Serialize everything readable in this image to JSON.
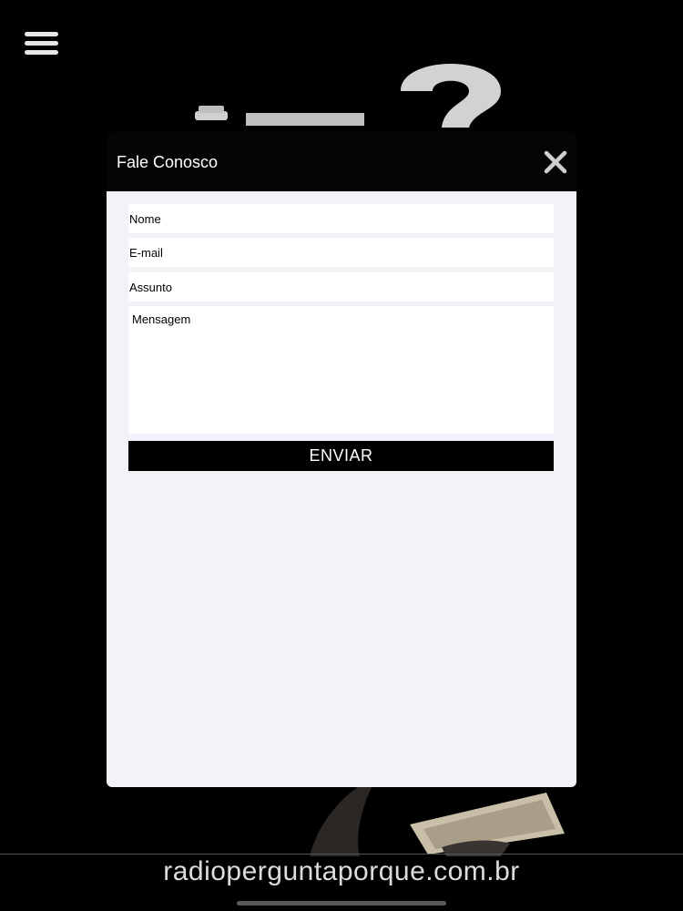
{
  "menu": {
    "icon": "hamburger-menu-icon"
  },
  "modal": {
    "title": "Fale Conosco",
    "close_icon": "close-icon",
    "form": {
      "name_placeholder": "Nome",
      "email_placeholder": "E-mail",
      "subject_placeholder": "Assunto",
      "message_placeholder": "Mensagem",
      "submit_label": "ENVIAR"
    }
  },
  "footer": {
    "domain": "radioperguntaporque.com.br"
  },
  "colors": {
    "background": "#000000",
    "modal_body": "#f3f2f8",
    "button": "#000000",
    "footer_text": "#dcdcdc"
  }
}
